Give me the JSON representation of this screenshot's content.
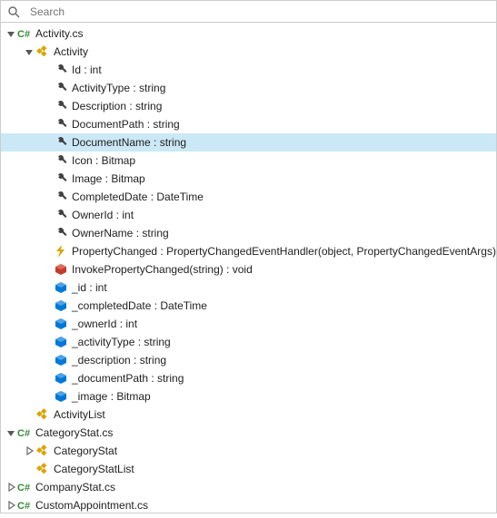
{
  "search": {
    "placeholder": "Search"
  },
  "tree": {
    "n0": {
      "label": "Activity.cs"
    },
    "n0_0": {
      "label": "Activity"
    },
    "n0_0_0": {
      "label": "Id : int"
    },
    "n0_0_1": {
      "label": "ActivityType : string"
    },
    "n0_0_2": {
      "label": "Description : string"
    },
    "n0_0_3": {
      "label": "DocumentPath : string"
    },
    "n0_0_4": {
      "label": "DocumentName : string"
    },
    "n0_0_5": {
      "label": "Icon : Bitmap"
    },
    "n0_0_6": {
      "label": "Image : Bitmap"
    },
    "n0_0_7": {
      "label": "CompletedDate : DateTime"
    },
    "n0_0_8": {
      "label": "OwnerId : int"
    },
    "n0_0_9": {
      "label": "OwnerName : string"
    },
    "n0_0_10": {
      "label": "PropertyChanged : PropertyChangedEventHandler(object, PropertyChangedEventArgs)"
    },
    "n0_0_11": {
      "label": "InvokePropertyChanged(string) : void"
    },
    "n0_0_12": {
      "label": "_id : int"
    },
    "n0_0_13": {
      "label": "_completedDate : DateTime"
    },
    "n0_0_14": {
      "label": "_ownerId : int"
    },
    "n0_0_15": {
      "label": "_activityType : string"
    },
    "n0_0_16": {
      "label": "_description : string"
    },
    "n0_0_17": {
      "label": "_documentPath : string"
    },
    "n0_0_18": {
      "label": "_image : Bitmap"
    },
    "n0_1": {
      "label": "ActivityList"
    },
    "n1": {
      "label": "CategoryStat.cs"
    },
    "n1_0": {
      "label": "CategoryStat"
    },
    "n1_1": {
      "label": "CategoryStatList"
    },
    "n2": {
      "label": "CompanyStat.cs"
    },
    "n3": {
      "label": "CustomAppointment.cs"
    }
  }
}
